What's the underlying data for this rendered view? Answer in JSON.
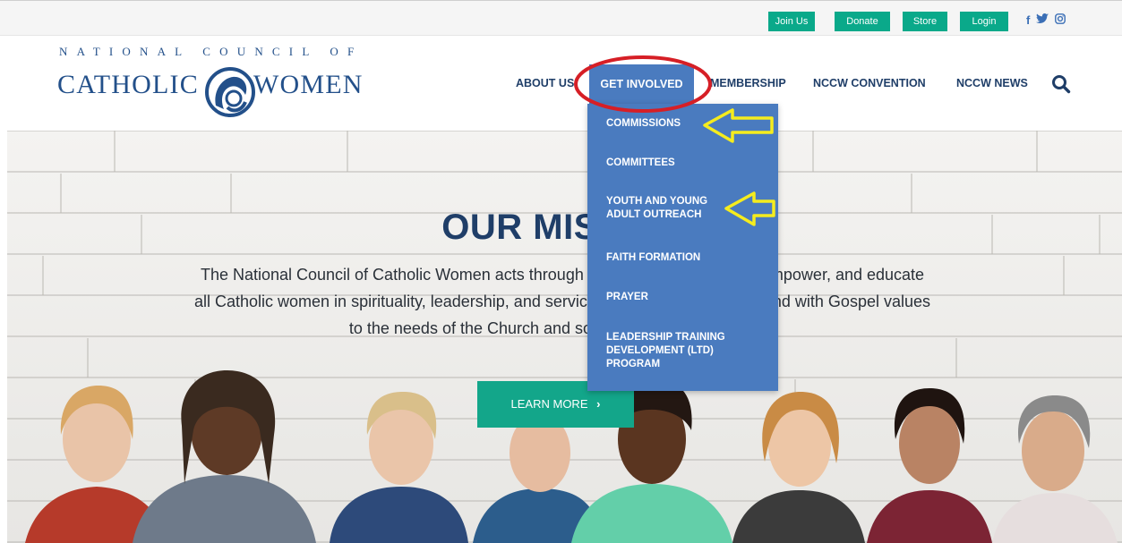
{
  "topbar": {
    "join_label": "Join Us",
    "donate_label": "Donate",
    "store_label": "Store",
    "login_label": "Login",
    "social_icons": [
      "facebook-icon",
      "twitter-icon",
      "instagram-icon"
    ],
    "button_color": "#0aa98a"
  },
  "logo": {
    "top_line": "NATIONAL COUNCIL OF",
    "left_word": "CATHOLIC",
    "right_word": "WOMEN",
    "color": "#23508a"
  },
  "nav": {
    "items": [
      "ABOUT US",
      "GET INVOLVED",
      "MEMBERSHIP",
      "NCCW CONVENTION",
      "NCCW NEWS"
    ],
    "active": "GET INVOLVED",
    "active_color": "#4a7bbf",
    "search_icon": "search-icon"
  },
  "dropdown": {
    "items": [
      "COMMISSIONS",
      "COMMITTEES",
      "YOUTH AND YOUNG ADULT OUTREACH",
      "FAITH FORMATION",
      "PRAYER",
      "LEADERSHIP TRAINING DEVELOPMENT (LTD) PROGRAM"
    ]
  },
  "hero": {
    "title": "OUR MISSION",
    "text": "The National Council of Catholic Women acts through its members to support, empower, and educate all Catholic women in spirituality, leadership, and service. NCCW programs respond with Gospel values to the needs of the Church and society in the modern world.",
    "button_label": "LEARN MORE",
    "button_color": "#13a68a"
  },
  "annotations": {
    "circle_color": "#d61f26",
    "arrow_color": "#f5ec1e"
  }
}
